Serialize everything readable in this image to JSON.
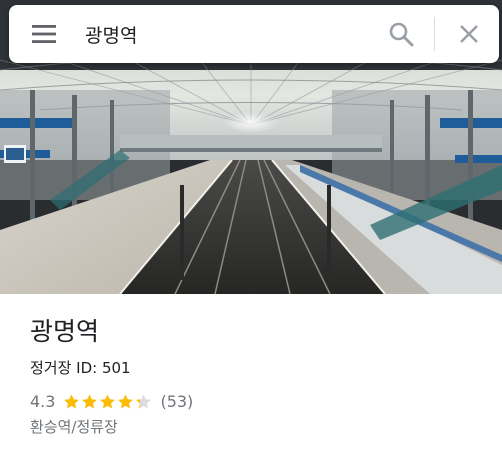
{
  "search": {
    "query": "광명역",
    "menu_icon": "hamburger-menu-icon",
    "search_icon": "magnifier-icon",
    "close_icon": "close-x-icon"
  },
  "photo": {
    "subject": "photo"
  },
  "place": {
    "name": "광명역",
    "stop_id": "정거장 ID: 501",
    "rating": "4.3",
    "rating_value": 4.3,
    "review_count": "(53)",
    "category": "환승역/정류장"
  },
  "colors": {
    "star": "#fbbc04",
    "star_empty": "#dadce0",
    "text_primary": "#202124",
    "text_secondary": "#70757a",
    "icon_gray": "#5f6368"
  }
}
